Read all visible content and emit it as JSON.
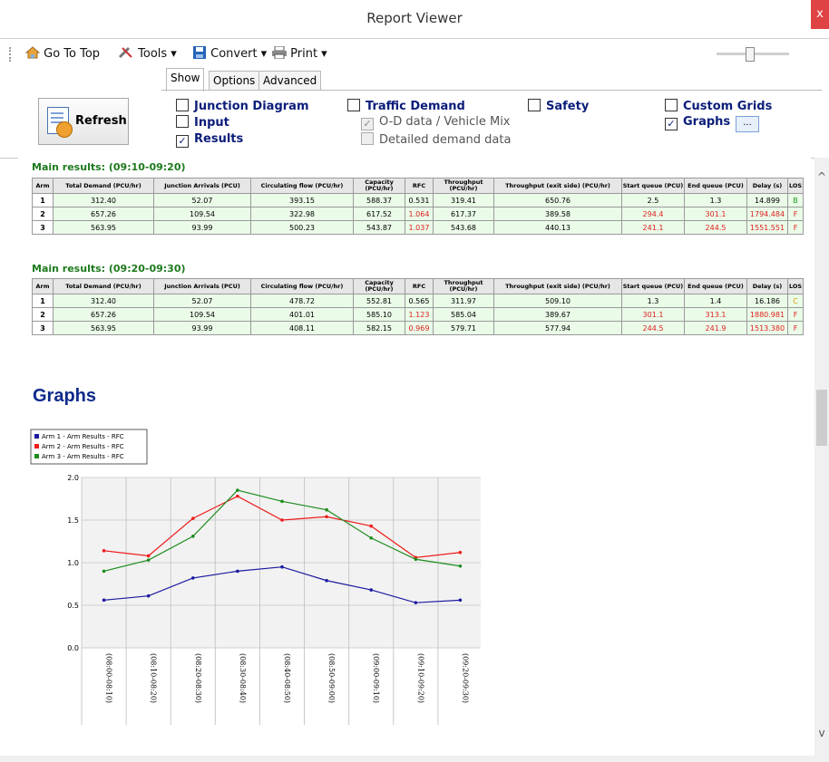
{
  "window": {
    "title": "Report Viewer",
    "close": "x"
  },
  "toolbar": {
    "go_to_top": "Go To Top",
    "tools": "Tools ▾",
    "convert": "Convert ▾",
    "print": "Print ▾"
  },
  "tabs": [
    {
      "label": "Show"
    },
    {
      "label": "Options"
    },
    {
      "label": "Advanced"
    }
  ],
  "refresh_label": "Refresh",
  "checkboxes": {
    "junction_diagram": {
      "label": "Junction Diagram",
      "checked": false
    },
    "input": {
      "label": "Input",
      "checked": false
    },
    "results": {
      "label": "Results",
      "checked": true
    },
    "traffic_demand": {
      "label": "Traffic Demand",
      "checked": false
    },
    "od_data": {
      "label": "O-D data / Vehicle Mix",
      "checked": true
    },
    "detailed_demand": {
      "label": "Detailed demand data",
      "checked": false
    },
    "safety": {
      "label": "Safety",
      "checked": false
    },
    "custom_grids": {
      "label": "Custom Grids",
      "checked": false
    },
    "graphs": {
      "label": "Graphs",
      "checked": true
    }
  },
  "ellipsis_label": "...",
  "tables": [
    {
      "title": "Main results: (09:10-09:20)",
      "headers": [
        "Arm",
        "Total Demand (PCU/hr)",
        "Junction Arrivals (PCU)",
        "Circulating flow (PCU/hr)",
        "Capacity (PCU/hr)",
        "RFC",
        "Throughput (PCU/hr)",
        "Throughput (exit side) (PCU/hr)",
        "Start queue (PCU)",
        "End queue (PCU)",
        "Delay (s)",
        "LOS"
      ],
      "rows": [
        [
          "1",
          "312.40",
          "52.07",
          "393.15",
          "588.37",
          "0.531",
          "319.41",
          "650.76",
          "2.5",
          "1.3",
          "14.899",
          "B"
        ],
        [
          "2",
          "657.26",
          "109.54",
          "322.98",
          "617.52",
          "1.064",
          "617.37",
          "389.58",
          "294.4",
          "301.1",
          "1794.484",
          "F"
        ],
        [
          "3",
          "563.95",
          "93.99",
          "500.23",
          "543.87",
          "1.037",
          "543.68",
          "440.13",
          "241.1",
          "244.5",
          "1551.551",
          "F"
        ]
      ],
      "red": [
        [
          1,
          5
        ],
        [
          1,
          8
        ],
        [
          1,
          9
        ],
        [
          1,
          10
        ],
        [
          2,
          5
        ],
        [
          2,
          8
        ],
        [
          2,
          9
        ],
        [
          2,
          10
        ]
      ]
    },
    {
      "title": "Main results: (09:20-09:30)",
      "headers": [
        "Arm",
        "Total Demand (PCU/hr)",
        "Junction Arrivals (PCU)",
        "Circulating flow (PCU/hr)",
        "Capacity (PCU/hr)",
        "RFC",
        "Throughput (PCU/hr)",
        "Throughput (exit side) (PCU/hr)",
        "Start queue (PCU)",
        "End queue (PCU)",
        "Delay (s)",
        "LOS"
      ],
      "rows": [
        [
          "1",
          "312.40",
          "52.07",
          "478.72",
          "552.81",
          "0.565",
          "311.97",
          "509.10",
          "1.3",
          "1.4",
          "16.186",
          "C"
        ],
        [
          "2",
          "657.26",
          "109.54",
          "401.01",
          "585.10",
          "1.123",
          "585.04",
          "389.67",
          "301.1",
          "313.1",
          "1880.981",
          "F"
        ],
        [
          "3",
          "563.95",
          "93.99",
          "408.11",
          "582.15",
          "0.969",
          "579.71",
          "577.94",
          "244.5",
          "241.9",
          "1513.380",
          "F"
        ]
      ],
      "red": [
        [
          1,
          5
        ],
        [
          1,
          8
        ],
        [
          1,
          9
        ],
        [
          1,
          10
        ],
        [
          2,
          5
        ],
        [
          2,
          8
        ],
        [
          2,
          9
        ],
        [
          2,
          10
        ]
      ]
    }
  ],
  "graphs_heading": "Graphs",
  "chart_data": {
    "type": "line",
    "categories": [
      "(08:00-08:10)",
      "(08:10-08:20)",
      "(08:20-08:30)",
      "(08:30-08:40)",
      "(08:40-08:50)",
      "(08:50-09:00)",
      "(09:00-09:10)",
      "(09:10-09:20)",
      "(09:20-09:30)"
    ],
    "series": [
      {
        "name": "Arm 1 - Arm Results - RFC",
        "color": "#1a1aa0",
        "values": [
          0.56,
          0.61,
          0.82,
          0.9,
          0.95,
          0.79,
          0.68,
          0.53,
          0.56
        ]
      },
      {
        "name": "Arm 2 - Arm Results - RFC",
        "color": "#ee1c1c",
        "values": [
          1.14,
          1.08,
          1.52,
          1.78,
          1.5,
          1.54,
          1.43,
          1.06,
          1.12
        ]
      },
      {
        "name": "Arm 3 - Arm Results - RFC",
        "color": "#1e8c1e",
        "values": [
          0.9,
          1.03,
          1.31,
          1.85,
          1.72,
          1.62,
          1.29,
          1.04,
          0.96
        ]
      }
    ],
    "yticks": [
      "0.0",
      "0.5",
      "1.0",
      "1.5",
      "2.0"
    ],
    "ylim": [
      0,
      2.0
    ],
    "grid": true,
    "legend": "top-left"
  }
}
